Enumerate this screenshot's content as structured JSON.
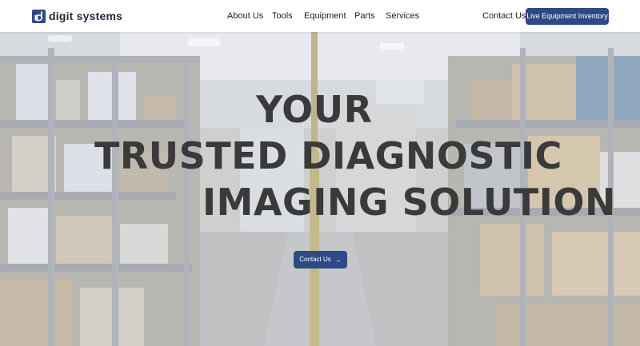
{
  "brand": {
    "name": "digit systems",
    "logo_icon": "d-square-logo-icon",
    "accent": "#2e4a85"
  },
  "nav": {
    "items": [
      {
        "label": "About Us"
      },
      {
        "label": "Tools"
      },
      {
        "label": "Equipment"
      },
      {
        "label": "Parts"
      },
      {
        "label": "Services"
      }
    ],
    "contact_label": "Contact Us",
    "inventory_button": "Live Equipment Inventory"
  },
  "hero": {
    "background": "warehouse-shelves-photo",
    "headline": [
      "YOUR",
      "TRUSTED DIAGNOSTIC",
      "IMAGING SOLUTION"
    ],
    "button_label": "Contact Us",
    "button_icon": "arrow-right-icon",
    "text_color": "#3a3a3a"
  }
}
